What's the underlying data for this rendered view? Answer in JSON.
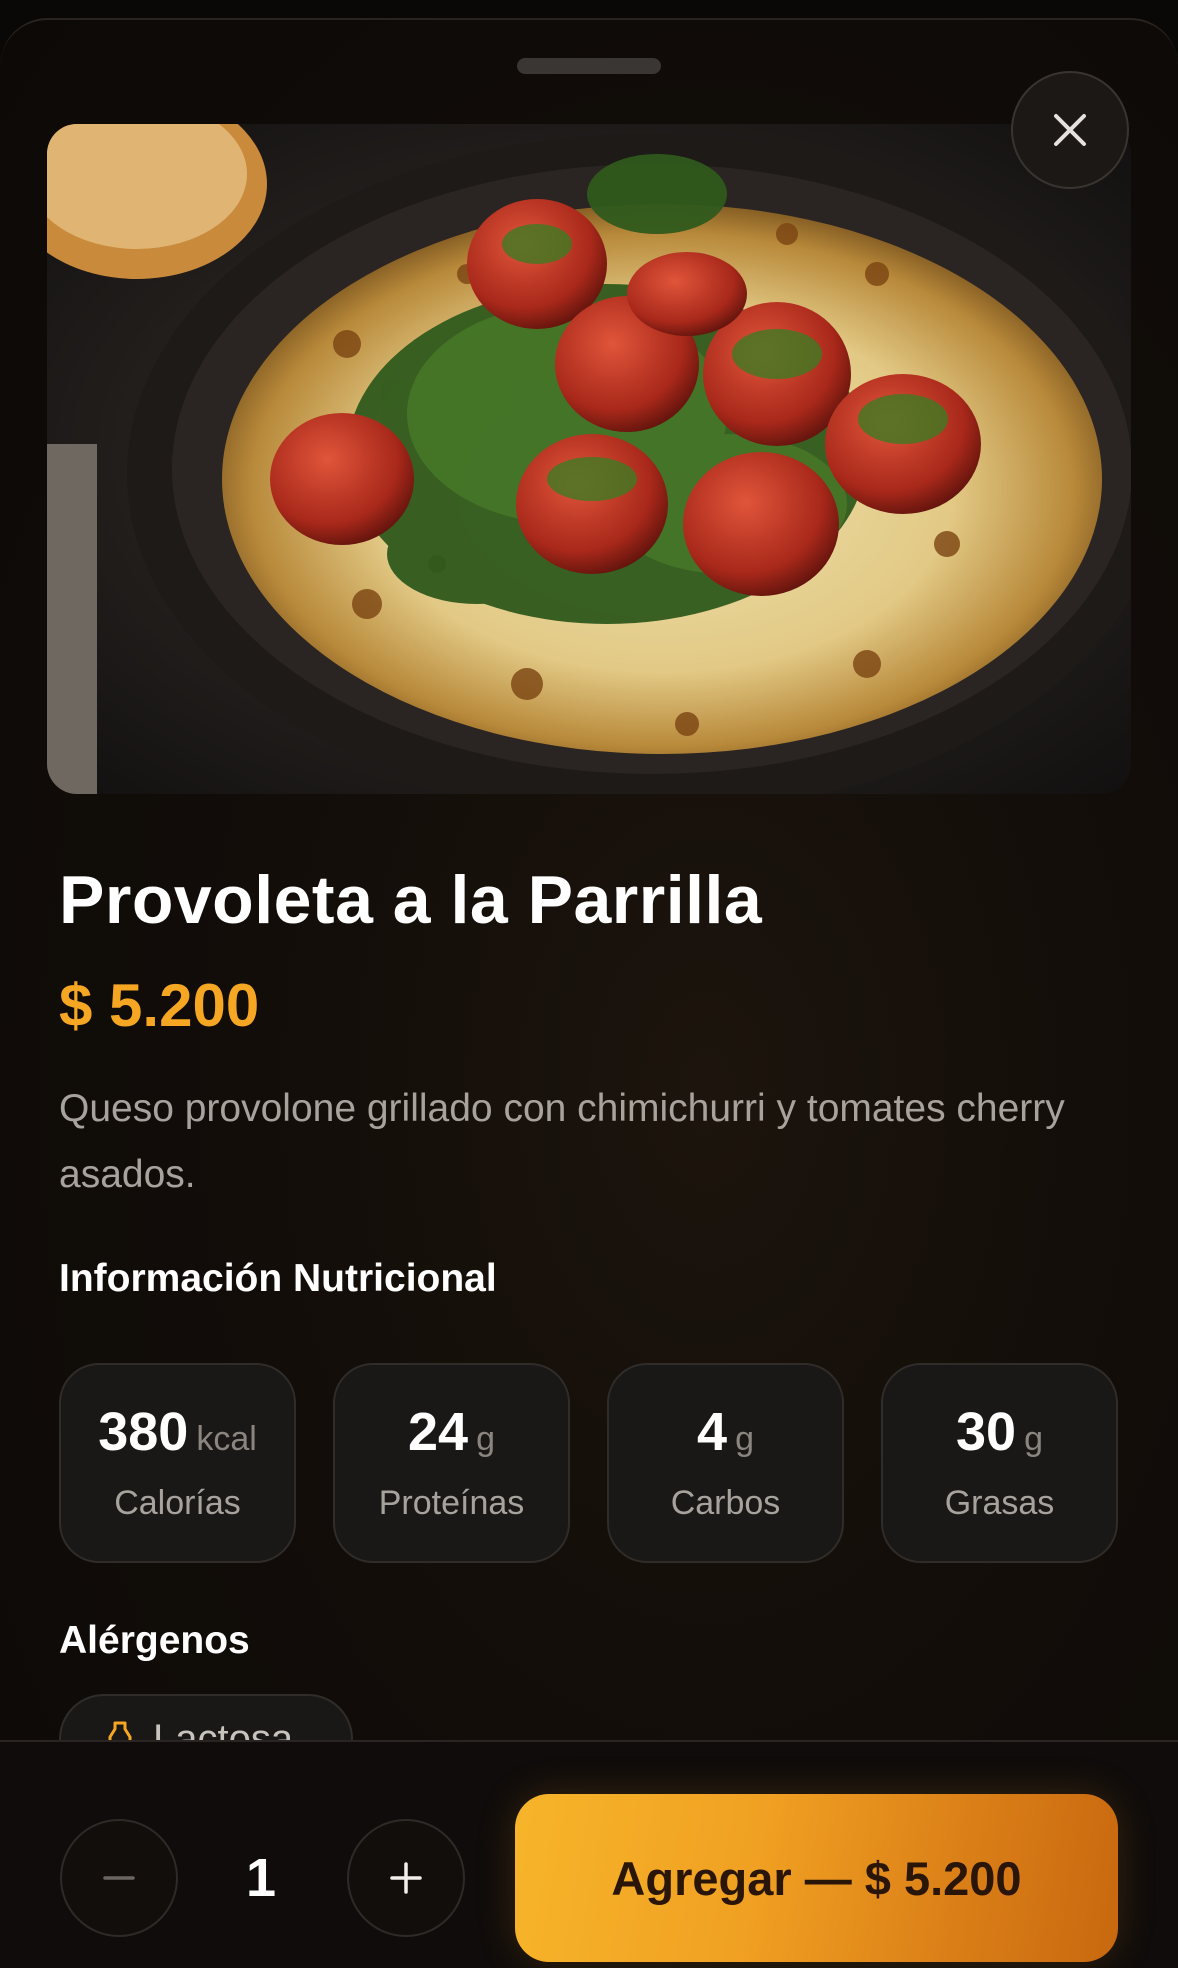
{
  "product": {
    "name": "Provoleta a la Parrilla",
    "price": "$ 5.200",
    "description": "Queso provolone grillado con chimichurri y tomates cherry asados."
  },
  "nutrition": {
    "title": "Información Nutricional",
    "items": [
      {
        "value": "380",
        "unit": "kcal",
        "label": "Calorías"
      },
      {
        "value": "24",
        "unit": "g",
        "label": "Proteínas"
      },
      {
        "value": "4",
        "unit": "g",
        "label": "Carbos"
      },
      {
        "value": "30",
        "unit": "g",
        "label": "Grasas"
      }
    ]
  },
  "allergens": {
    "title": "Alérgenos",
    "items": [
      {
        "label": "Lactosa",
        "icon": "milk-bottle-icon"
      }
    ]
  },
  "cart": {
    "quantity": "1",
    "add_label": "Agregar — $ 5.200"
  },
  "icons": {
    "close": "close-icon",
    "minus": "minus-icon",
    "plus": "plus-icon"
  },
  "colors": {
    "accent": "#f5a623",
    "button_gradient_start": "#f7b52a",
    "button_gradient_end": "#c8680f",
    "background": "#120d09"
  }
}
